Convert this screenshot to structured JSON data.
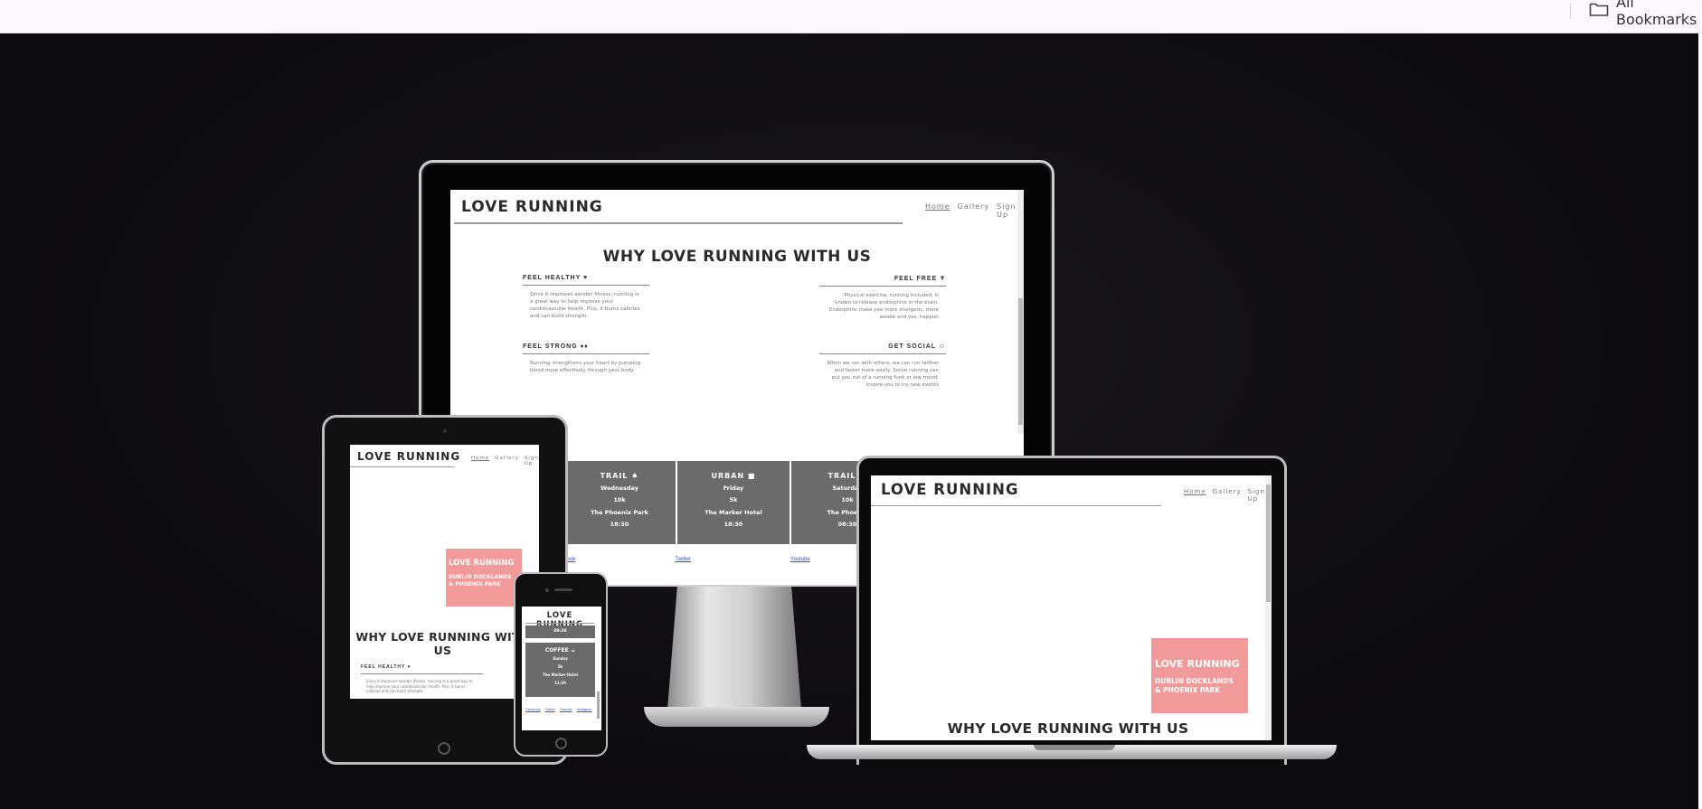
{
  "browser": {
    "bookmarks_label": "All Bookmarks"
  },
  "site": {
    "title": "LOVE RUNNING",
    "nav": [
      "Home",
      "Gallery",
      "Sign Up"
    ],
    "why_heading": "WHY LOVE RUNNING WITH US",
    "why_heading_short_1": "WHY LOVE RUNNING WITH",
    "why_heading_short_2": "US",
    "hero_title": "LOVE RUNNING",
    "hero_sub_1": "DUBLIN DOCKLANDS",
    "hero_sub_2": "& PHOENIX PARK",
    "features": [
      {
        "title": "FEEL HEALTHY ♥",
        "text": "Since it improves aerobic fitness, running is a great way to help improve your cardiovascular health. Plus, it burns calories and can build strength."
      },
      {
        "title": "FEEL FREE ✝",
        "text": "Physical exercise, running included, is known to release endorphins in the brain. Endorphins make you more energetic, more awake and yes, happier"
      },
      {
        "title": "FEEL STRONG ♦♦",
        "text": "Running strengthens your heart by pumping blood more effectively through your body."
      },
      {
        "title": "GET SOCIAL ☺",
        "text": "When we run with others, we can run farther and faster more easily. Social running can put you out of a running funk or low mood, inspire you to try new events"
      }
    ],
    "schedule": [
      {
        "type": "TRAIL ♠",
        "day": "Wednesday",
        "distance": "10k",
        "place": "The Phoenix Park",
        "time": "18:30"
      },
      {
        "type": "URBAN ■",
        "day": "Friday",
        "distance": "5k",
        "place": "The Marker Hotel",
        "time": "18:30"
      },
      {
        "type": "TRAIL ♠",
        "day": "Saturday",
        "distance": "10k",
        "place": "The Phoenix",
        "time": "08:30"
      },
      {
        "type": "COFFEE ☕",
        "day": "",
        "distance": "",
        "place": "",
        "time": ""
      }
    ],
    "phone_card": {
      "type": "COFFEE ☕",
      "day": "Sunday",
      "distance": "5k",
      "place": "The Marker Hotel",
      "time": "11:30",
      "top_time": "09:30"
    },
    "social_links": [
      "Facebook",
      "Twitter",
      "Youtube",
      "Instagram"
    ],
    "desktop_links": [
      "Facebook",
      "Twitter",
      "Youtube"
    ]
  },
  "colors": {
    "hero_pink": "#f2999a",
    "card_grey": "#6b6b6b",
    "link_blue": "#3355cc"
  }
}
